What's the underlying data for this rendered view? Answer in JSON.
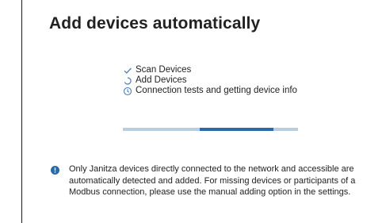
{
  "dialog": {
    "title": "Add devices automatically"
  },
  "steps": [
    {
      "label": "Scan Devices",
      "state": "done",
      "icon": "check-icon"
    },
    {
      "label": "Add Devices",
      "state": "in-progress",
      "icon": "spinner-icon"
    },
    {
      "label": "Connection tests and getting device info",
      "state": "pending",
      "icon": "clock-icon"
    }
  ],
  "progress": {
    "start_fraction": 0.44,
    "end_fraction": 0.86
  },
  "info": {
    "icon": "info-icon",
    "text": "Only Janitza devices directly connected to the network and accessible are automatically detected and added. For missing devices or participants of a Modbus connection, please use the manual adding option in the settings."
  },
  "colors": {
    "accent": "#2b6aa8",
    "track": "#b9cde0",
    "icon": "#4a7fb5"
  }
}
